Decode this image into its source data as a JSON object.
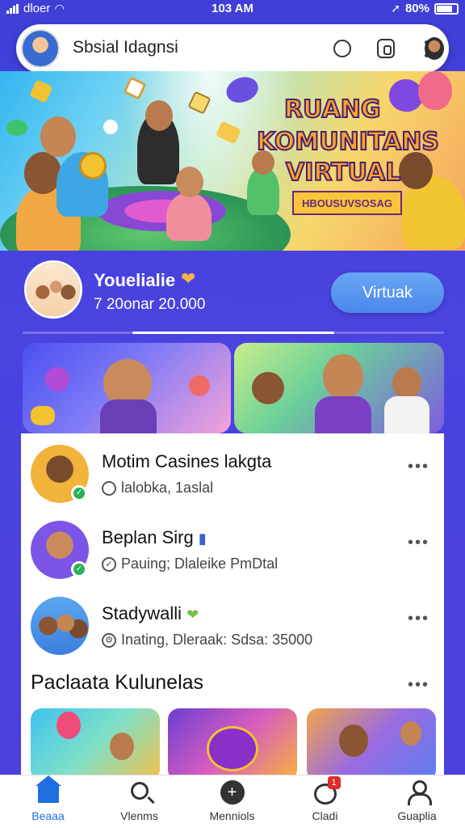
{
  "status_bar": {
    "carrier": "dloer",
    "time": "103 AM",
    "battery": "80%",
    "battery_level": 0.8
  },
  "topbar": {
    "title": "Sbsial Idagnsi"
  },
  "hero": {
    "line1": "RUANG",
    "line2": "KOMUNITANS",
    "line3": "VIRTUAL",
    "ribbon": "HBOUSUVSOSAG"
  },
  "profile": {
    "name": "Youelialie",
    "meta": "7 20onar 20.000",
    "button_label": "Virtuak"
  },
  "list": [
    {
      "title": "Motim Casines lakgta",
      "subtitle": "lalobka, 1aslal",
      "badge": true
    },
    {
      "title": "Beplan Sirg",
      "subtitle": "Pauing; Dlaleike PmDtal",
      "badge": true
    },
    {
      "title": "Stadywalli",
      "subtitle": "Inating, Dleraak: Sdsa: 35000",
      "badge": false
    }
  ],
  "section": {
    "title": "Paclaata Kulunelas"
  },
  "nav": [
    {
      "label": "Beaaa",
      "icon": "home-icon",
      "active": true
    },
    {
      "label": "Vlenms",
      "icon": "search-icon",
      "active": false
    },
    {
      "label": "Menniols",
      "icon": "plus-icon",
      "active": false
    },
    {
      "label": "Cladi",
      "icon": "chat-icon",
      "active": false,
      "badge": "1"
    },
    {
      "label": "Guaplia",
      "icon": "user-icon",
      "active": false
    }
  ],
  "colors": {
    "background": "#4341dc",
    "accent": "#1f6fe0",
    "badge_green": "#28b155",
    "notification_red": "#e02b2b"
  }
}
